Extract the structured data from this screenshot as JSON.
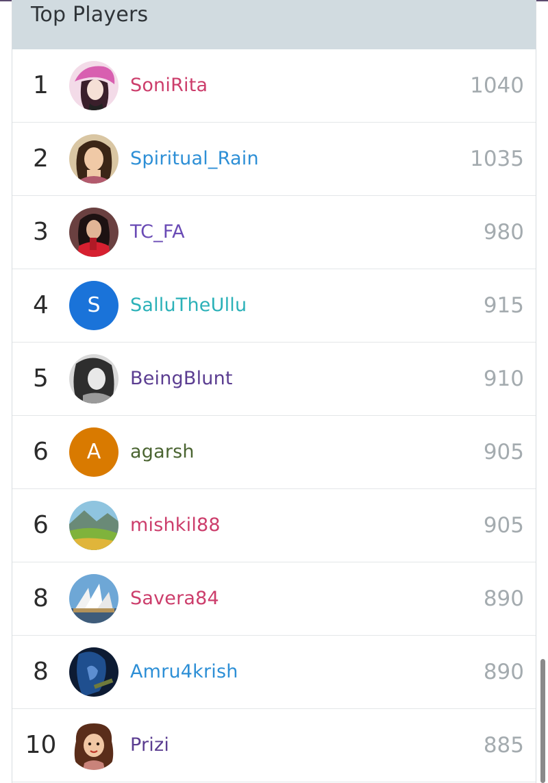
{
  "header": {
    "title": "Top Players"
  },
  "players": [
    {
      "rank": "1",
      "name": "SoniRita",
      "score": "1040",
      "name_color": "#cc3d6b",
      "avatar": "photo-woman-pink-icon"
    },
    {
      "rank": "2",
      "name": "Spiritual_Rain",
      "score": "1035",
      "name_color": "#2d8fd6",
      "avatar": "photo-woman-icon"
    },
    {
      "rank": "3",
      "name": "TC_FA",
      "score": "980",
      "name_color": "#6a4bb5",
      "avatar": "photo-woman-red-icon"
    },
    {
      "rank": "4",
      "name": "SalluTheUllu",
      "score": "915",
      "name_color": "#2bb1b8",
      "avatar": "letter-avatar",
      "letter": "S",
      "avatar_color": "#1a73d9"
    },
    {
      "rank": "5",
      "name": "BeingBlunt",
      "score": "910",
      "name_color": "#5b3d91",
      "avatar": "photo-woman-bw-icon"
    },
    {
      "rank": "6",
      "name": "agarsh",
      "score": "905",
      "name_color": "#4a6431",
      "avatar": "letter-avatar",
      "letter": "A",
      "avatar_color": "#d97a00"
    },
    {
      "rank": "6",
      "name": "mishkil88",
      "score": "905",
      "name_color": "#cc3d6b",
      "avatar": "landscape-icon"
    },
    {
      "rank": "8",
      "name": "Savera84",
      "score": "890",
      "name_color": "#cc3d6b",
      "avatar": "opera-house-icon"
    },
    {
      "rank": "8",
      "name": "Amru4krish",
      "score": "890",
      "name_color": "#2d8fd6",
      "avatar": "night-portrait-icon"
    },
    {
      "rank": "10",
      "name": "Prizi",
      "score": "885",
      "name_color": "#5b3d91",
      "avatar": "cartoon-girl-icon"
    }
  ],
  "colors": {
    "header_bg": "#d1dbe0",
    "score_text": "#a4abaf",
    "rank_text": "#2b2b2b"
  }
}
